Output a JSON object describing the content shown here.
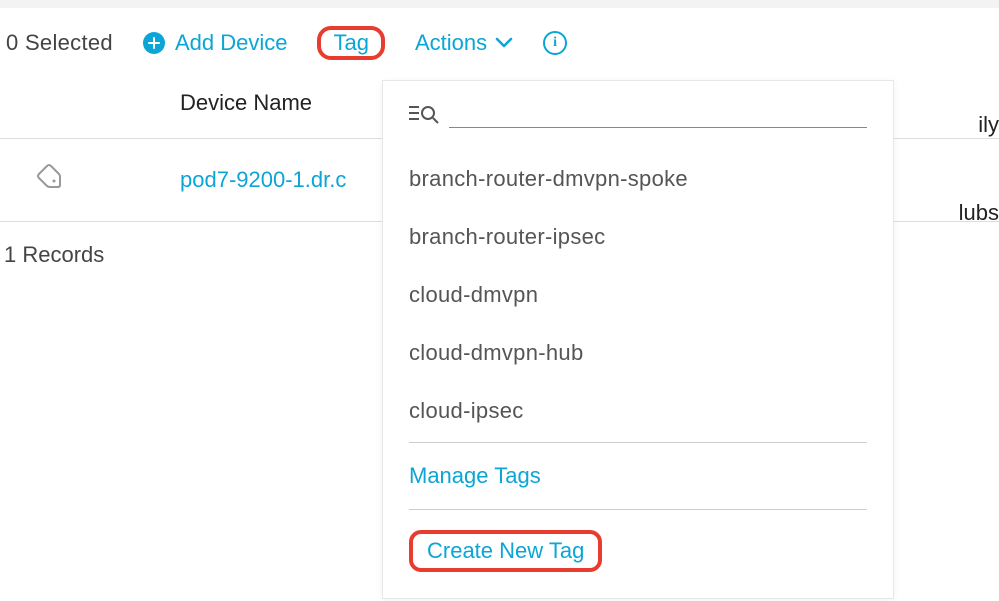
{
  "toolbar": {
    "selected_text": "0 Selected",
    "add_device_label": "Add Device",
    "tag_label": "Tag",
    "actions_label": "Actions"
  },
  "table": {
    "header_device_name": "Device Name",
    "row": {
      "device_name": "pod7-9200-1.dr.c"
    },
    "records_text": "1 Records",
    "family_partial": "ily",
    "hubs_partial": "lubs"
  },
  "tag_dropdown": {
    "items": [
      "branch-router-dmvpn-spoke",
      "branch-router-ipsec",
      "cloud-dmvpn",
      "cloud-dmvpn-hub",
      "cloud-ipsec"
    ],
    "manage_label": "Manage Tags",
    "create_label": "Create New Tag"
  }
}
